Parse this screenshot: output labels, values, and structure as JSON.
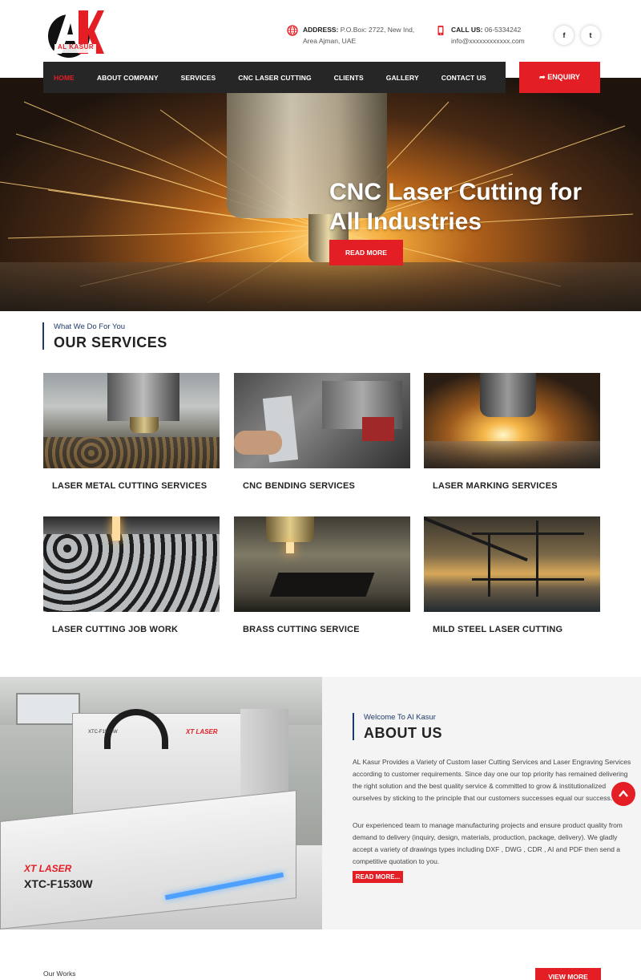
{
  "header": {
    "logo_text": "AK",
    "logo_name": "AL KASUR",
    "logo_tagline": "STEEL WORK AND POWDER COATING",
    "address_label": "ADDRESS:",
    "address_value": "P.O.Box: 2722, New Ind,",
    "address_line2": "Area Ajman, UAE",
    "call_label": "CALL US:",
    "call_value": "06-5334242",
    "email": "info@xxxxxxxxxxxx.com",
    "social_facebook": "f",
    "social_twitter": "t"
  },
  "nav": {
    "items": [
      "HOME",
      "ABOUT COMPANY",
      "SERVICES",
      "CNC LASER CUTTING",
      "CLIENTS",
      "GALLERY",
      "CONTACT US"
    ],
    "enquiry": "ENQUIRY"
  },
  "hero": {
    "title": "CNC Laser Cutting for All Industries",
    "button": "READ MORE"
  },
  "services": {
    "subtitle": "What We Do For You",
    "title": "OUR SERVICES",
    "cards": [
      "LASER METAL CUTTING SERVICES",
      "CNC BENDING SERVICES",
      "LASER MARKING SERVICES",
      "LASER CUTTING JOB WORK",
      "BRASS CUTTING SERVICE",
      "MILD STEEL LASER CUTTING"
    ]
  },
  "about": {
    "subtitle": "Welcome To Al Kasur",
    "title": "ABOUT US",
    "paragraph1": "AL Kasur Provides a Variety of Custom laser Cutting Services and Laser Engraving Services according to customer requirements. Since day one our top priority has remained delivering the right solution and the best quality service & committed to grow & institutionalized ourselves by sticking to the principle that our customers successes equal our success.",
    "paragraph2": "Our experienced team to manage manufacturing projects and ensure product quality from demand to delivery (inquiry, design, materials, production, package, delivery). We gladly accept a variety of drawings types including DXF , DWG , CDR , AI and PDF then send a competitive quotation to you.",
    "button": "READ MORE...",
    "machine_label": "XTC-F1530W",
    "brand_label": "XT LASER"
  },
  "works": {
    "label": "Our Works",
    "button": "VIEW MORE"
  },
  "colors": {
    "accent": "#e31e24",
    "nav_bg": "#262626",
    "heading_rule": "#1d3a6b"
  }
}
